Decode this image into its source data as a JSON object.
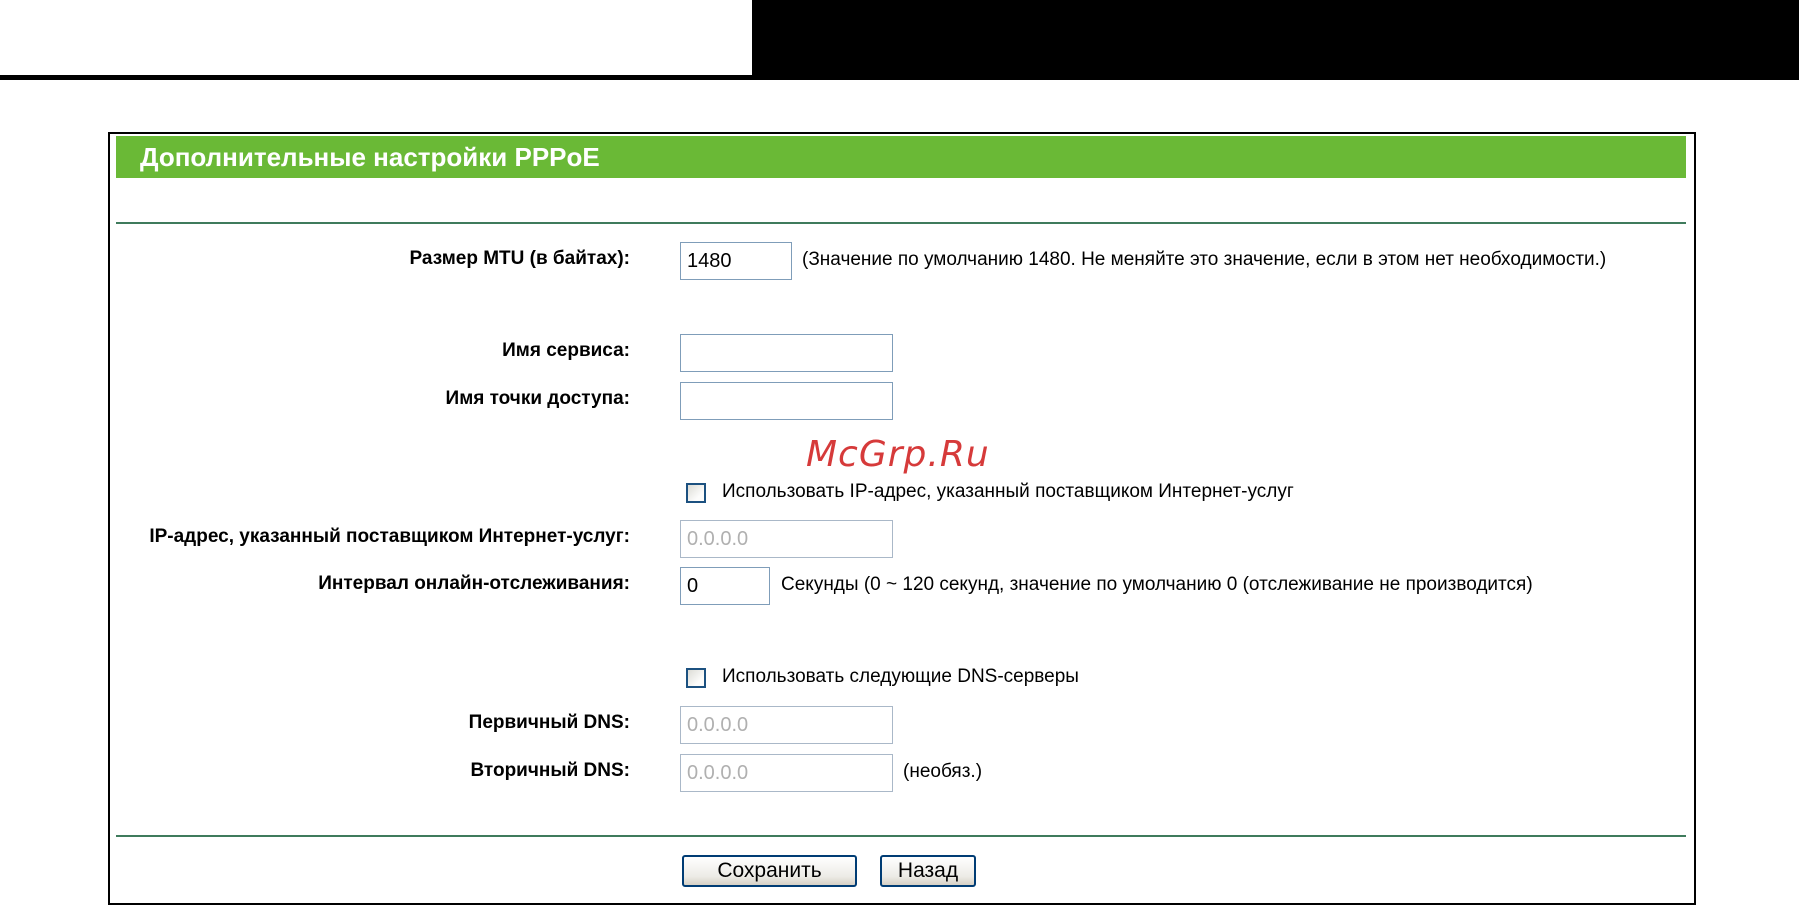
{
  "page": {
    "title": "Дополнительные настройки PPPoE"
  },
  "mtu": {
    "label": "Размер MTU (в байтах):",
    "value": "1480",
    "hint": "(Значение по умолчанию 1480. Не меняйте это значение, если в этом нет необходимости.)"
  },
  "service_name": {
    "label": "Имя сервиса:",
    "value": ""
  },
  "ac_name": {
    "label": "Имя точки доступа:",
    "value": ""
  },
  "watermark": "McGrp.Ru",
  "use_isp_ip": {
    "label": "Использовать IP-адрес, указанный поставщиком Интернет-услуг",
    "checked": false
  },
  "isp_ip": {
    "label": "IP-адрес, указанный поставщиком Интернет-услуг:",
    "value": "0.0.0.0"
  },
  "echo_interval": {
    "label": "Интервал онлайн-отслеживания:",
    "value": "0",
    "hint": "Секунды (0 ~ 120 секунд, значение по умолчанию 0 (отслеживание не производится)"
  },
  "use_dns": {
    "label": "Использовать следующие DNS-серверы",
    "checked": false
  },
  "primary_dns": {
    "label": "Первичный DNS:",
    "value": "0.0.0.0"
  },
  "secondary_dns": {
    "label": "Вторичный DNS:",
    "value": "0.0.0.0",
    "hint": "(необяз.)"
  },
  "buttons": {
    "save": "Сохранить",
    "back": "Назад"
  },
  "colors": {
    "title_bar": "#6ab936",
    "divider": "#3f7b5c",
    "watermark": "#d63a3a"
  }
}
